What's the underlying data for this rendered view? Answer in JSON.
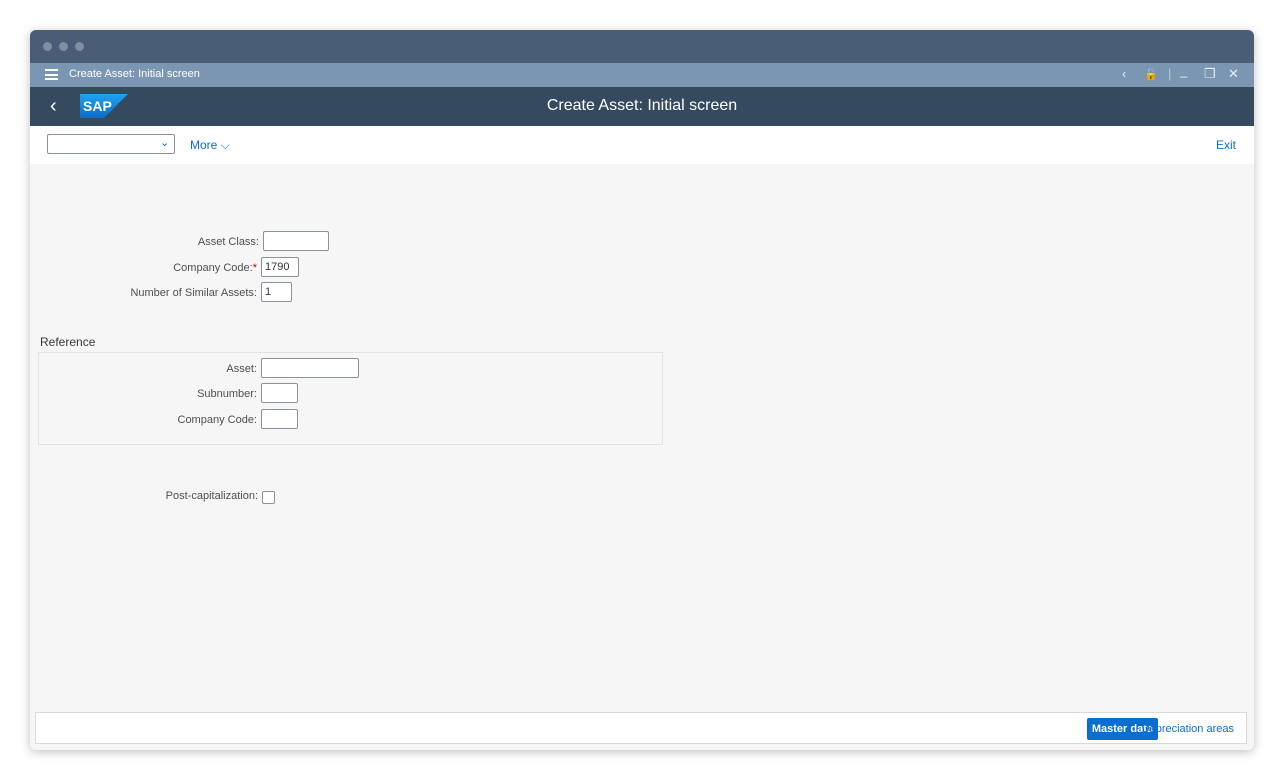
{
  "window": {
    "tab_title": "Create Asset: Initial screen",
    "controls": {
      "back": "‹",
      "lock": "🔓",
      "divider": "|",
      "minimize": "_",
      "restore": "❐",
      "close": "✕"
    }
  },
  "shellbar": {
    "back_glyph": "‹",
    "logo_text": "SAP",
    "title": "Create Asset: Initial screen"
  },
  "toolbar": {
    "command_select": {
      "value": "",
      "chevron": "⌄"
    },
    "more_label": "More ⌵",
    "exit_label": "Exit"
  },
  "form": {
    "asset_class": {
      "label": "Asset Class:",
      "value": ""
    },
    "company_code": {
      "label": "Company Code:",
      "required_mark": "*",
      "value": "1790"
    },
    "similar_assets": {
      "label": "Number of Similar Assets:",
      "value": "1"
    }
  },
  "reference": {
    "title": "Reference",
    "asset": {
      "label": "Asset:",
      "value": ""
    },
    "subnumber": {
      "label": "Subnumber:",
      "value": ""
    },
    "company_code": {
      "label": "Company Code:",
      "value": ""
    }
  },
  "post_capitalization": {
    "label": "Post-capitalization:",
    "checked": false
  },
  "footer": {
    "master_data_label": "Master data",
    "depreciation_areas_label": "Depreciation areas"
  },
  "colors": {
    "shell": "#354a5f",
    "titlebar": "#7b96b3",
    "accent": "#0a6ed1",
    "required": "#bb0000"
  }
}
